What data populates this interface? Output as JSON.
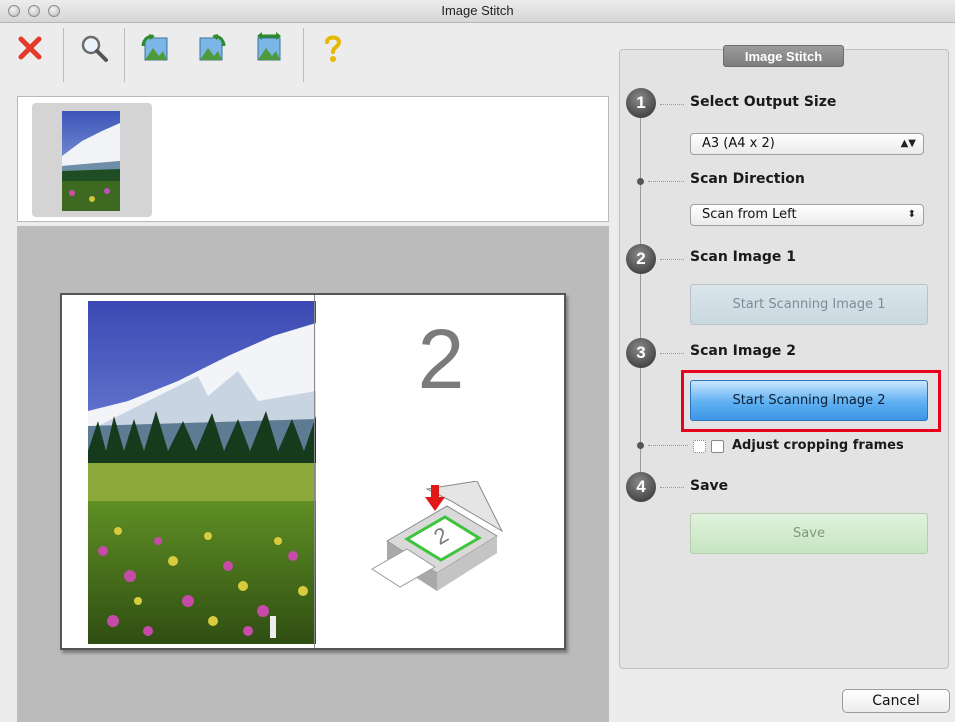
{
  "window": {
    "title": "Image Stitch"
  },
  "toolbar": {
    "buttons": [
      {
        "icon": "close-x-icon"
      },
      {
        "icon": "magnifier-icon"
      },
      {
        "icon": "image-rotate-left-icon"
      },
      {
        "icon": "image-rotate-right-icon"
      },
      {
        "icon": "image-flip-icon"
      },
      {
        "icon": "help-icon"
      }
    ]
  },
  "preview": {
    "placeholder_number": "2"
  },
  "panel": {
    "title": "Image Stitch",
    "steps": [
      {
        "number": "1",
        "label": "Select Output Size"
      },
      {
        "number": "2",
        "label": "Scan Image 1"
      },
      {
        "number": "3",
        "label": "Scan Image 2"
      },
      {
        "number": "4",
        "label": "Save"
      }
    ],
    "output_size": {
      "value": "A3 (A4 x 2)"
    },
    "scan_direction": {
      "label": "Scan Direction",
      "value": "Scan from Left"
    },
    "scan1_button": "Start Scanning Image 1",
    "scan2_button": "Start Scanning Image 2",
    "adjust_cropping": {
      "label": "Adjust cropping frames",
      "checked": false
    },
    "save_button": "Save"
  },
  "footer": {
    "cancel": "Cancel"
  },
  "colors": {
    "highlight": "#e8001c",
    "primary_button": "#3c95e6",
    "close_x": "#e53b2a"
  }
}
